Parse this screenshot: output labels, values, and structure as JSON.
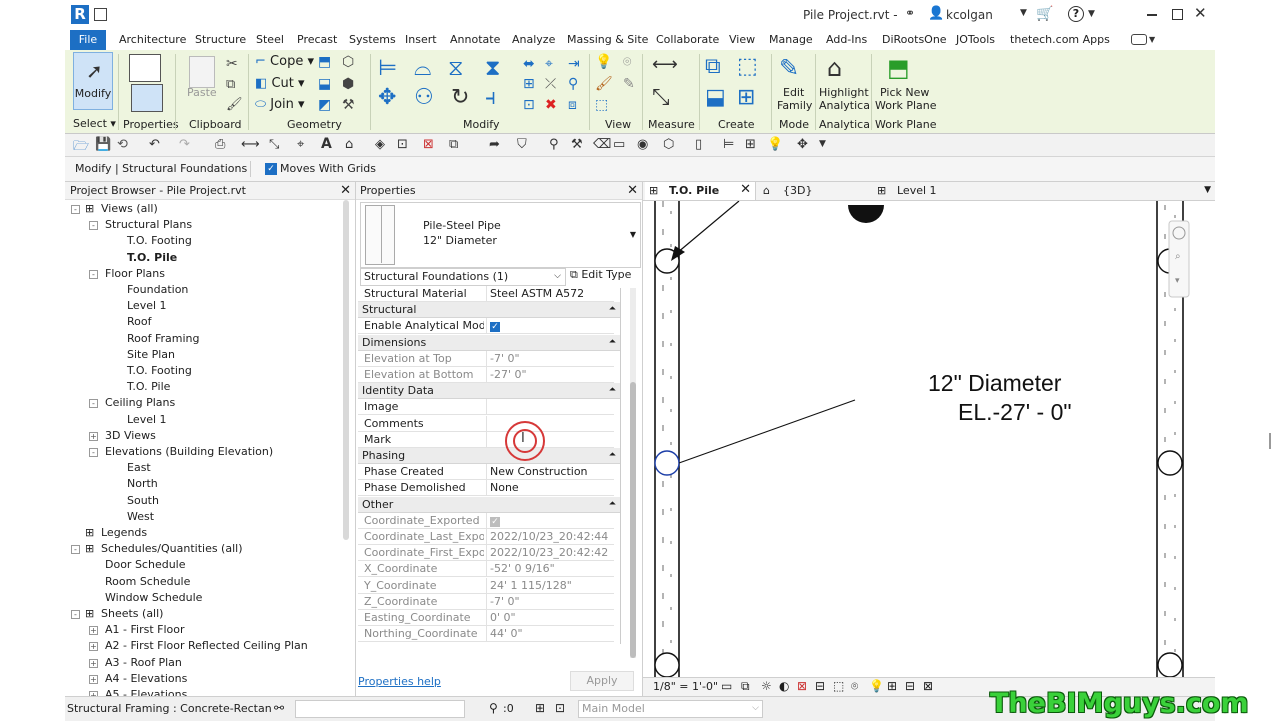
{
  "titlebar": {
    "app_letter": "R",
    "file_name": "Pile Project.rvt -",
    "user": "kcolgan"
  },
  "ribbon_tabs": [
    "File",
    "Architecture",
    "Structure",
    "Steel",
    "Precast",
    "Systems",
    "Insert",
    "Annotate",
    "Analyze",
    "Massing & Site",
    "Collaborate",
    "View",
    "Manage",
    "Add-Ins",
    "DiRootsOne",
    "JOTools",
    "thetech.com Apps"
  ],
  "ribbon": {
    "modify_label": "Modify",
    "select_label": "Select",
    "properties_label": "Properties",
    "paste_label": "Paste",
    "clipboard_label": "Clipboard",
    "cope_label": "Cope",
    "cut_label": "Cut",
    "join_label": "Join",
    "geometry_label": "Geometry",
    "modify_panel_label": "Modify",
    "view_label": "View",
    "measure_label": "Measure",
    "create_label": "Create",
    "edit_family_label_1": "Edit",
    "edit_family_label_2": "Family",
    "mode_label": "Mode",
    "highlight_label_1": "Highlight",
    "highlight_label_2": "Analytical",
    "analytical_label": "Analytical",
    "pick_new_label_1": "Pick New",
    "pick_new_label_2": "Work Plane",
    "work_plane_label": "Work Plane"
  },
  "options_bar": {
    "context": "Modify | Structural Foundations",
    "moves_with_grids": "Moves With Grids"
  },
  "browser": {
    "title": "Project Browser - Pile Project.rvt",
    "items": [
      {
        "label": "Views (all)",
        "level": 0,
        "exp": "-"
      },
      {
        "label": "Structural Plans",
        "level": 1,
        "exp": "-"
      },
      {
        "label": "T.O. Footing",
        "level": 2,
        "exp": ""
      },
      {
        "label": "T.O. Pile",
        "level": 2,
        "exp": "",
        "bold": true
      },
      {
        "label": "Floor Plans",
        "level": 1,
        "exp": "-"
      },
      {
        "label": "Foundation",
        "level": 2,
        "exp": ""
      },
      {
        "label": "Level 1",
        "level": 2,
        "exp": ""
      },
      {
        "label": "Roof",
        "level": 2,
        "exp": ""
      },
      {
        "label": "Roof Framing",
        "level": 2,
        "exp": ""
      },
      {
        "label": "Site Plan",
        "level": 2,
        "exp": ""
      },
      {
        "label": "T.O. Footing",
        "level": 2,
        "exp": ""
      },
      {
        "label": "T.O. Pile",
        "level": 2,
        "exp": ""
      },
      {
        "label": "Ceiling Plans",
        "level": 1,
        "exp": "-"
      },
      {
        "label": "Level 1",
        "level": 2,
        "exp": ""
      },
      {
        "label": "3D Views",
        "level": 1,
        "exp": "+"
      },
      {
        "label": "Elevations (Building Elevation)",
        "level": 1,
        "exp": "-"
      },
      {
        "label": "East",
        "level": 2,
        "exp": ""
      },
      {
        "label": "North",
        "level": 2,
        "exp": ""
      },
      {
        "label": "South",
        "level": 2,
        "exp": ""
      },
      {
        "label": "West",
        "level": 2,
        "exp": ""
      },
      {
        "label": "Legends",
        "level": 0,
        "exp": ""
      },
      {
        "label": "Schedules/Quantities (all)",
        "level": 0,
        "exp": "-"
      },
      {
        "label": "Door Schedule",
        "level": 1,
        "exp": ""
      },
      {
        "label": "Room Schedule",
        "level": 1,
        "exp": ""
      },
      {
        "label": "Window Schedule",
        "level": 1,
        "exp": ""
      },
      {
        "label": "Sheets (all)",
        "level": 0,
        "exp": "-"
      },
      {
        "label": "A1 - First Floor",
        "level": 1,
        "exp": "+"
      },
      {
        "label": "A2 - First Floor Reflected Ceiling Plan",
        "level": 1,
        "exp": "+"
      },
      {
        "label": "A3 - Roof Plan",
        "level": 1,
        "exp": "+"
      },
      {
        "label": "A4 - Elevations",
        "level": 1,
        "exp": "+"
      },
      {
        "label": "A5 - Elevations",
        "level": 1,
        "exp": "+"
      }
    ]
  },
  "properties": {
    "title": "Properties",
    "type_name_1": "Pile-Steel Pipe",
    "type_name_2": "12\" Diameter",
    "filter": "Structural Foundations (1)",
    "edit_type": "Edit Type",
    "rows": [
      {
        "kind": "row",
        "name": "Structural Material",
        "value": "Steel ASTM A572"
      },
      {
        "kind": "hdr",
        "name": "Structural"
      },
      {
        "kind": "row",
        "name": "Enable Analytical Model",
        "value": "",
        "check": true
      },
      {
        "kind": "hdr",
        "name": "Dimensions"
      },
      {
        "kind": "row",
        "name": "Elevation at Top",
        "value": "-7'  0\"",
        "grey": true
      },
      {
        "kind": "row",
        "name": "Elevation at Bottom",
        "value": "-27'  0\"",
        "grey": true
      },
      {
        "kind": "hdr",
        "name": "Identity Data"
      },
      {
        "kind": "row",
        "name": "Image",
        "value": ""
      },
      {
        "kind": "row",
        "name": "Comments",
        "value": ""
      },
      {
        "kind": "row",
        "name": "Mark",
        "value": ""
      },
      {
        "kind": "hdr",
        "name": "Phasing"
      },
      {
        "kind": "row",
        "name": "Phase Created",
        "value": "New Construction"
      },
      {
        "kind": "row",
        "name": "Phase Demolished",
        "value": "None"
      },
      {
        "kind": "hdr",
        "name": "Other"
      },
      {
        "kind": "row",
        "name": "Coordinate_Exported",
        "value": "",
        "check": true,
        "grey": true
      },
      {
        "kind": "row",
        "name": "Coordinate_Last_Export...",
        "value": "2022/10/23_20:42:44",
        "grey": true
      },
      {
        "kind": "row",
        "name": "Coordinate_First_Expor...",
        "value": "2022/10/23_20:42:42",
        "grey": true
      },
      {
        "kind": "row",
        "name": "X_Coordinate",
        "value": "-52'  0 9/16\"",
        "grey": true
      },
      {
        "kind": "row",
        "name": "Y_Coordinate",
        "value": "24'  1 115/128\"",
        "grey": true
      },
      {
        "kind": "row",
        "name": "Z_Coordinate",
        "value": "-7'  0\"",
        "grey": true
      },
      {
        "kind": "row",
        "name": "Easting_Coordinate",
        "value": "0'  0\"",
        "grey": true
      },
      {
        "kind": "row",
        "name": "Northing_Coordinate",
        "value": "44'  0\"",
        "grey": true
      }
    ],
    "help": "Properties help",
    "apply": "Apply"
  },
  "view_tabs": [
    {
      "label": "T.O. Pile",
      "active": true
    },
    {
      "label": "{3D}",
      "active": false
    },
    {
      "label": "Level 1",
      "active": false
    }
  ],
  "drawing": {
    "tag_line_1": "12\" Diameter",
    "tag_line_2": "EL.-27' - 0\"",
    "scale": "1/8\" = 1'-0\""
  },
  "status": {
    "text": "Structural Framing : Concrete-Rectangular",
    "count": ":0",
    "model": "Main Model"
  },
  "watermark": "TheBIMguys.com",
  "colors": {
    "accent": "#1d6fc4",
    "ribbon_bg": "#eef5df",
    "watermark": "#3ad13a"
  }
}
